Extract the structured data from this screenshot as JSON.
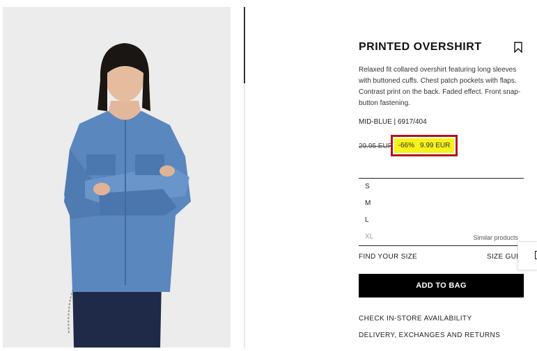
{
  "product": {
    "title": "PRINTED OVERSHIRT",
    "description": "Relaxed fit collared overshirt featuring long sleeves with buttoned cuffs. Chest patch pockets with flaps. Contrast print on the back. Faded effect. Front snap-button fastening.",
    "color_ref": "MID-BLUE | 6917/404",
    "old_price": "29.95 EUR",
    "discount": "-66%",
    "price": "9.99 EUR"
  },
  "sizes": [
    {
      "label": "S",
      "available": true
    },
    {
      "label": "M",
      "available": true
    },
    {
      "label": "L",
      "available": true
    },
    {
      "label": "XL",
      "available": false,
      "note": "Similar products"
    }
  ],
  "actions": {
    "find_size": "FIND YOUR SIZE",
    "size_guide": "SIZE GUIDE",
    "add_to_bag": "ADD TO BAG",
    "check_store": "CHECK IN-STORE AVAILABILITY",
    "delivery": "DELIVERY, EXCHANGES AND RETURNS"
  },
  "icons": {
    "bookmark": "bookmark-icon",
    "side_tab": "side-panel-icon"
  },
  "colors": {
    "highlight": "#f6f21a",
    "highlight_border": "#b3121b",
    "button_bg": "#000000",
    "denim": "#5b87bf"
  }
}
